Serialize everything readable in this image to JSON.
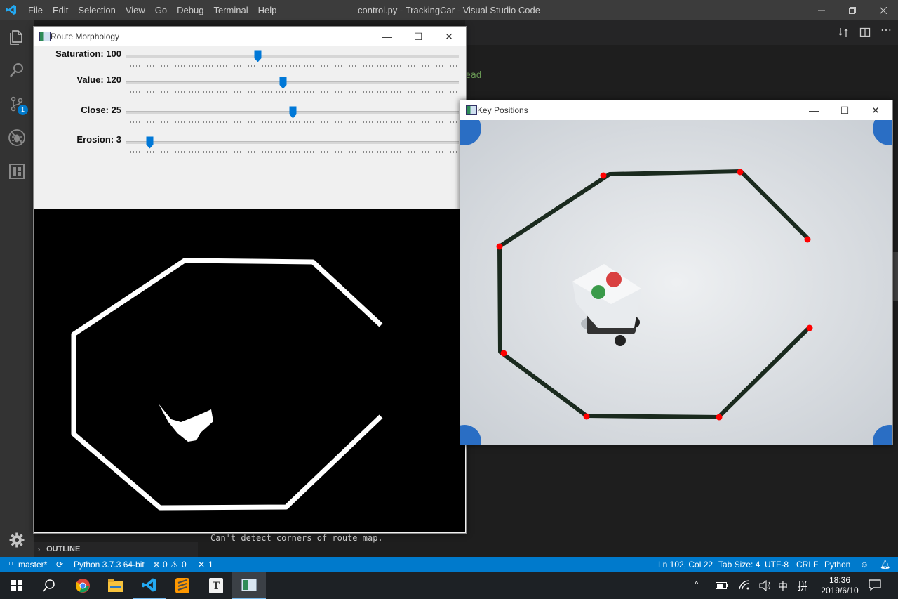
{
  "vscode": {
    "menu": [
      "File",
      "Edit",
      "Selection",
      "View",
      "Go",
      "Debug",
      "Terminal",
      "Help"
    ],
    "title": "control.py - TrackingCar - Visual Studio Code",
    "editor_fragment": "ead",
    "panel_output": "Can't detect corners of route map.",
    "outline_label": "OUTLINE",
    "scm_badge": "1",
    "status": {
      "branch": "master*",
      "python": "Python 3.7.3 64-bit",
      "errors": "0",
      "warnings": "0",
      "tools": "1",
      "position": "Ln 102, Col 22",
      "tab_size": "Tab Size: 4",
      "encoding": "UTF-8",
      "eol": "CRLF",
      "language": "Python"
    }
  },
  "route_window": {
    "title": "Route Morphology",
    "sliders": [
      {
        "label": "Saturation: 100",
        "fraction": 0.395
      },
      {
        "label": "Value: 120",
        "fraction": 0.47
      },
      {
        "label": "Close: 25",
        "fraction": 0.5
      },
      {
        "label": "Erosion: 3",
        "fraction": 0.07
      }
    ]
  },
  "key_window": {
    "title": "Key Positions"
  },
  "taskbar": {
    "time": "18:36",
    "date": "2019/6/10",
    "ime": "中",
    "ime2": "拼",
    "apps": [
      "start-icon",
      "search-icon",
      "chrome-icon",
      "file-explorer-icon",
      "vscode-icon",
      "sublime-icon",
      "typora-icon",
      "opencv-window-icon"
    ]
  },
  "colors": {
    "accent": "#007acc",
    "slider_thumb": "#0078d7",
    "corner_dot": "#ff0000"
  }
}
